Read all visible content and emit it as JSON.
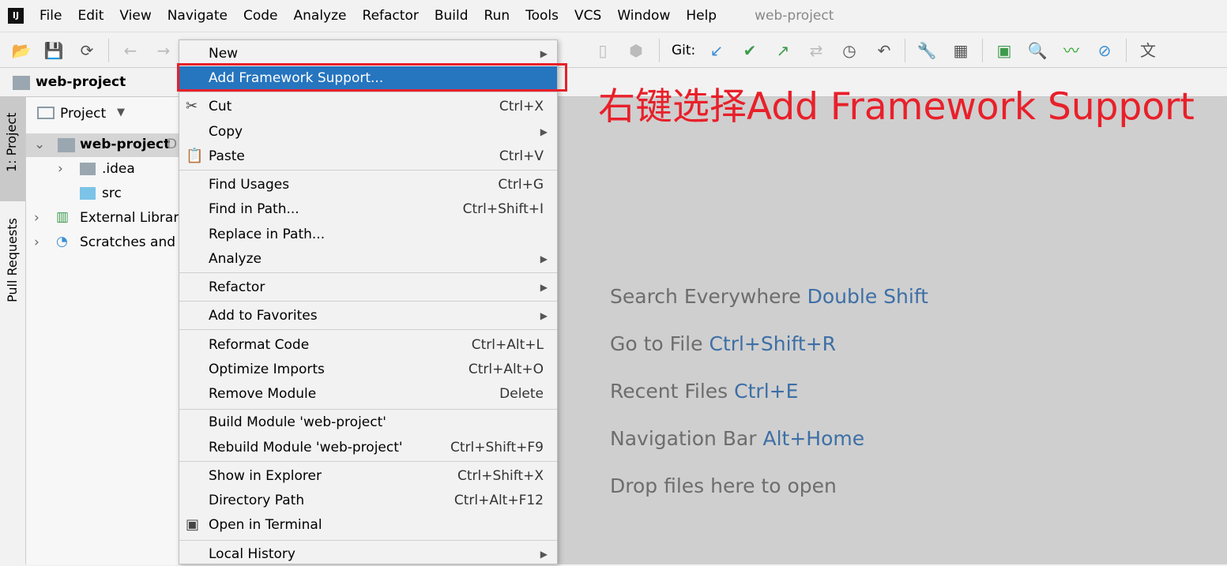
{
  "menubar": {
    "items": [
      "File",
      "Edit",
      "View",
      "Navigate",
      "Code",
      "Analyze",
      "Refactor",
      "Build",
      "Run",
      "Tools",
      "VCS",
      "Window",
      "Help"
    ],
    "title": "web-project"
  },
  "toolbar": {
    "git_label": "Git:"
  },
  "navbar": {
    "project": "web-project"
  },
  "side_tabs": {
    "project": "1: Project",
    "pull_requests": "Pull Requests"
  },
  "panel": {
    "selector": "Project",
    "root": "web-project",
    "root_suffix": "D",
    "items": [
      ".idea",
      "src",
      "External Libraries",
      "Scratches and Consoles"
    ]
  },
  "context_menu": {
    "items": [
      {
        "label": "New",
        "submenu": true
      },
      {
        "label": "Add Framework Support...",
        "selected": true
      },
      {
        "label": "Cut",
        "shortcut": "Ctrl+X"
      },
      {
        "label": "Copy",
        "submenu": true
      },
      {
        "label": "Paste",
        "shortcut": "Ctrl+V"
      },
      {
        "label": "Find Usages",
        "shortcut": "Ctrl+G"
      },
      {
        "label": "Find in Path...",
        "shortcut": "Ctrl+Shift+I"
      },
      {
        "label": "Replace in Path..."
      },
      {
        "label": "Analyze",
        "submenu": true
      },
      {
        "label": "Refactor",
        "submenu": true
      },
      {
        "label": "Add to Favorites",
        "submenu": true
      },
      {
        "label": "Reformat Code",
        "shortcut": "Ctrl+Alt+L"
      },
      {
        "label": "Optimize Imports",
        "shortcut": "Ctrl+Alt+O"
      },
      {
        "label": "Remove Module",
        "shortcut": "Delete"
      },
      {
        "label": "Build Module 'web-project'"
      },
      {
        "label": "Rebuild Module 'web-project'",
        "shortcut": "Ctrl+Shift+F9"
      },
      {
        "label": "Show in Explorer",
        "shortcut": "Ctrl+Shift+X"
      },
      {
        "label": "Directory Path",
        "shortcut": "Ctrl+Alt+F12"
      },
      {
        "label": "Open in Terminal"
      },
      {
        "label": "Local History",
        "submenu": true
      }
    ]
  },
  "editor_hints": [
    {
      "text": "Search Everywhere",
      "key": "Double Shift"
    },
    {
      "text": "Go to File",
      "key": "Ctrl+Shift+R"
    },
    {
      "text": "Recent Files",
      "key": "Ctrl+E"
    },
    {
      "text": "Navigation Bar",
      "key": "Alt+Home"
    },
    {
      "text": "Drop files here to open",
      "key": ""
    }
  ],
  "annotation": "右键选择Add Framework Support",
  "colors": {
    "selection": "#2675bf",
    "annotation": "#e8202a",
    "shortcut_key": "#3d6fa6"
  }
}
